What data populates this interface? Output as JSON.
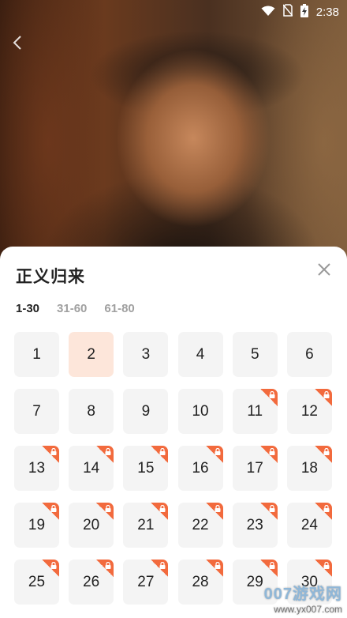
{
  "status": {
    "time": "2:38"
  },
  "sheet": {
    "title": "正义归来",
    "ranges": [
      {
        "label": "1-30",
        "active": true
      },
      {
        "label": "31-60",
        "active": false
      },
      {
        "label": "61-80",
        "active": false
      }
    ],
    "selected_episode": "2",
    "episodes": [
      {
        "n": "1",
        "locked": false
      },
      {
        "n": "2",
        "locked": false
      },
      {
        "n": "3",
        "locked": false
      },
      {
        "n": "4",
        "locked": false
      },
      {
        "n": "5",
        "locked": false
      },
      {
        "n": "6",
        "locked": false
      },
      {
        "n": "7",
        "locked": false
      },
      {
        "n": "8",
        "locked": false
      },
      {
        "n": "9",
        "locked": false
      },
      {
        "n": "10",
        "locked": false
      },
      {
        "n": "11",
        "locked": true
      },
      {
        "n": "12",
        "locked": true
      },
      {
        "n": "13",
        "locked": true
      },
      {
        "n": "14",
        "locked": true
      },
      {
        "n": "15",
        "locked": true
      },
      {
        "n": "16",
        "locked": true
      },
      {
        "n": "17",
        "locked": true
      },
      {
        "n": "18",
        "locked": true
      },
      {
        "n": "19",
        "locked": true
      },
      {
        "n": "20",
        "locked": true
      },
      {
        "n": "21",
        "locked": true
      },
      {
        "n": "22",
        "locked": true
      },
      {
        "n": "23",
        "locked": true
      },
      {
        "n": "24",
        "locked": true
      },
      {
        "n": "25",
        "locked": true
      },
      {
        "n": "26",
        "locked": true
      },
      {
        "n": "27",
        "locked": true
      },
      {
        "n": "28",
        "locked": true
      },
      {
        "n": "29",
        "locked": true
      },
      {
        "n": "30",
        "locked": true
      }
    ]
  },
  "colors": {
    "accent": "#f26a3d",
    "selected_bg": "#fde6da",
    "tile_bg": "#f4f4f4"
  },
  "watermark": {
    "main": "007游戏网",
    "sub": "www.yx007.com"
  }
}
